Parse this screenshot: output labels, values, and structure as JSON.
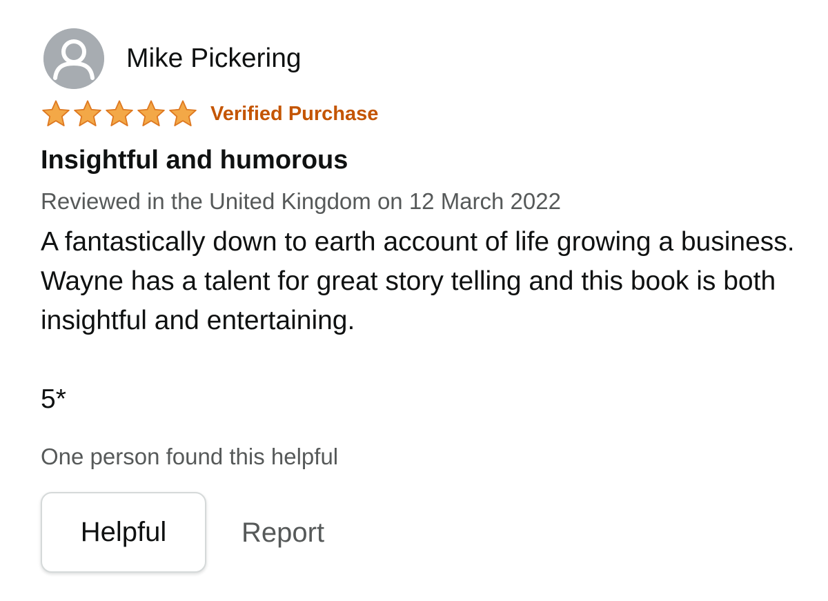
{
  "reviewer": {
    "name": "Mike Pickering",
    "avatar_icon": "user-avatar-icon"
  },
  "rating": {
    "stars": 5,
    "max_stars": 5,
    "star_color": "#f3a847",
    "star_outline_color": "#de7921"
  },
  "badge": {
    "verified_label": "Verified Purchase",
    "color": "#c45500"
  },
  "review": {
    "title": "Insightful and humorous",
    "date_line": "Reviewed in the United Kingdom on 12 March 2022",
    "body": "A fantastically down to earth account of life growing a business. Wayne has a talent for great story telling and this book is both insightful and entertaining.",
    "score_note": "5*"
  },
  "helpfulness": {
    "count_text": "One person found this helpful",
    "helpful_button": "Helpful",
    "report_link": "Report"
  }
}
